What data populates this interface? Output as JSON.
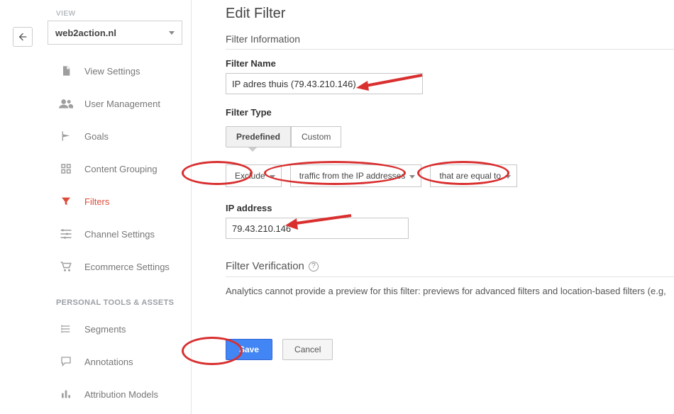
{
  "view": {
    "label": "VIEW",
    "selected": "web2action.nl"
  },
  "sidebar": {
    "items": [
      {
        "label": "View Settings"
      },
      {
        "label": "User Management"
      },
      {
        "label": "Goals"
      },
      {
        "label": "Content Grouping"
      },
      {
        "label": "Filters"
      },
      {
        "label": "Channel Settings"
      },
      {
        "label": "Ecommerce Settings"
      }
    ],
    "personal_header": "PERSONAL TOOLS & ASSETS",
    "personal": [
      {
        "label": "Segments"
      },
      {
        "label": "Annotations"
      },
      {
        "label": "Attribution Models"
      }
    ]
  },
  "main": {
    "heading": "Edit Filter",
    "filter_info_title": "Filter Information",
    "filter_name_label": "Filter Name",
    "filter_name_value": "IP adres thuis (79.43.210.146)",
    "filter_type_label": "Filter Type",
    "seg_predefined": "Predefined",
    "seg_custom": "Custom",
    "dropdowns": {
      "exclude": "Exclude",
      "traffic": "traffic from the IP addresses",
      "equal": "that are equal to"
    },
    "ip_label": "IP address",
    "ip_value": "79.43.210.146",
    "verify_title": "Filter Verification",
    "verify_text": "Analytics cannot provide a preview for this filter: previews for advanced filters and location-based filters (e.g,",
    "save": "Save",
    "cancel": "Cancel"
  }
}
